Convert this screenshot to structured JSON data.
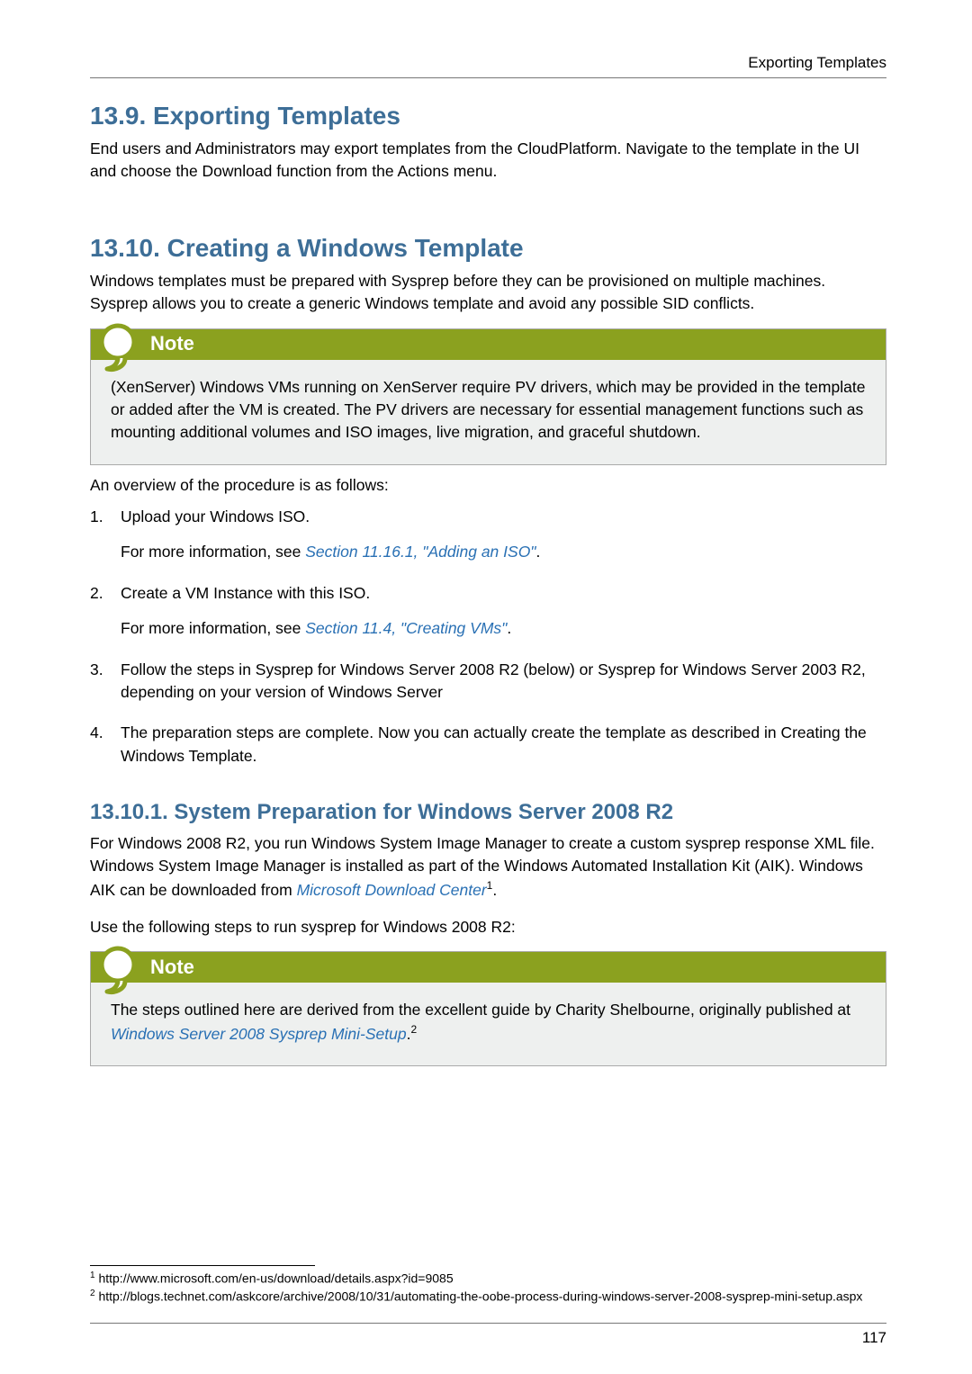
{
  "running_header": "Exporting Templates",
  "page_number": "117",
  "sec_13_9": {
    "title": "13.9. Exporting Templates",
    "para": "End users and Administrators may export templates from the CloudPlatform. Navigate to the template in the UI and choose the Download function from the Actions menu."
  },
  "sec_13_10": {
    "title": "13.10. Creating a Windows Template",
    "intro": "Windows templates must be prepared with Sysprep before they can be provisioned on multiple machines. Sysprep allows you to create a generic Windows template and avoid any possible SID conflicts.",
    "note_title": "Note",
    "note_body": "(XenServer) Windows VMs running on XenServer require PV drivers, which may be provided in the template or added after the VM is created. The PV drivers are necessary for essential management functions such as mounting additional volumes and ISO images, live migration, and graceful shutdown.",
    "after_note": "An overview of the procedure is as follows:",
    "steps": {
      "s1": "Upload your Windows ISO.",
      "s1_sub_pre": "For more information, see ",
      "s1_link": "Section 11.16.1, \"Adding an ISO\"",
      "s2": "Create a VM Instance with this ISO.",
      "s2_sub_pre": "For more information, see ",
      "s2_link": "Section 11.4, \"Creating VMs\"",
      "s3": "Follow the steps in Sysprep for Windows Server 2008 R2 (below) or Sysprep for Windows Server 2003 R2, depending on your version of Windows Server",
      "s4": "The preparation steps are complete. Now you can actually create the template as described in Creating the Windows Template."
    }
  },
  "sec_13_10_1": {
    "title": "13.10.1. System Preparation for Windows Server 2008 R2",
    "p1_a": "For Windows 2008 R2, you run Windows System Image Manager to create a custom sysprep response XML file. Windows System Image Manager is installed as part of the Windows Automated Installation Kit (AIK). Windows AIK can be downloaded from ",
    "p1_link": "Microsoft Download Center",
    "p1_sup": "1",
    "p2": "Use the following steps to run sysprep for Windows 2008 R2:",
    "note_title": "Note",
    "note_body_a": "The steps outlined here are derived from the excellent guide by Charity Shelbourne, originally published at ",
    "note_link": "Windows Server 2008 Sysprep Mini-Setup",
    "note_body_b": ".",
    "note_sup": "2"
  },
  "footnotes": {
    "f1": "http://www.microsoft.com/en-us/download/details.aspx?id=9085",
    "f2": "http://blogs.technet.com/askcore/archive/2008/10/31/automating-the-oobe-process-during-windows-server-2008-sysprep-mini-setup.aspx"
  }
}
